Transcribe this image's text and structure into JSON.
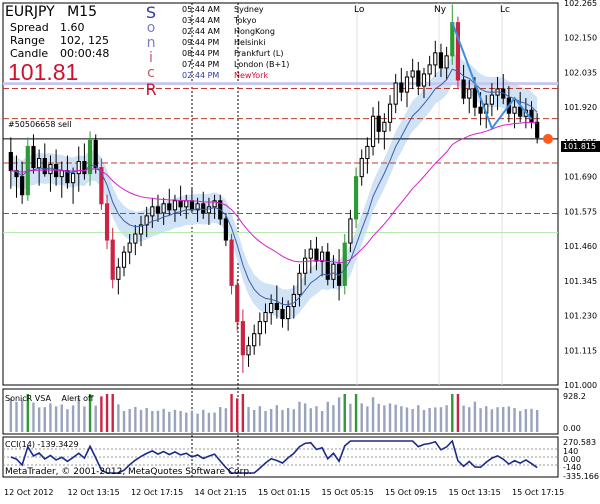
{
  "header": {
    "symbol": "EURJPY",
    "timeframe": "M15",
    "spread_label": "Spread",
    "spread_value": "1.60",
    "range_label": "Range",
    "range_value": "102, 125",
    "candle_label": "Candle",
    "candle_value": "00:00:48",
    "price": "101.81",
    "brand_letters": [
      "S",
      "o",
      "n",
      "i",
      "c",
      "R"
    ]
  },
  "sessions": [
    {
      "time": "05:44 AM",
      "name": "Sydney",
      "highlight": false
    },
    {
      "time": "03:44 AM",
      "name": "Tokyo",
      "highlight": false
    },
    {
      "time": "02:44 AM",
      "name": "HongKong",
      "highlight": false
    },
    {
      "time": "09:44 PM",
      "name": "Helsinki",
      "highlight": false
    },
    {
      "time": "08:44 PM",
      "name": "Frankfurt  (L)",
      "highlight": false
    },
    {
      "time": "07:44 PM",
      "name": "London  (B+1)",
      "highlight": false
    },
    {
      "time": "02:44 PM",
      "name": "NewYork",
      "highlight": true
    }
  ],
  "chart_labels": {
    "order_label": "#50506658 sell",
    "lo_label": "Lo",
    "ny_label": "Ny",
    "lc_label": "Lc",
    "current_price": "101.815"
  },
  "colors": {
    "bull": "#2d9a34",
    "bear": "#cc2244",
    "ma_fast": "#3d5fa8",
    "ma_slow": "#d81fc9",
    "band": "#cfe2f6",
    "dash_red": "#c0392b",
    "price_dot": "#ff5a1f",
    "accent_brand": "#2e3aa8"
  },
  "vsa_panel": {
    "label": "SonicR VSA",
    "alert": "Alert off",
    "scale_top": "928.2",
    "scale_bottom": "0.00"
  },
  "cci_panel": {
    "label": "CCI(14) -139.3429",
    "scale": [
      "270.583",
      "140",
      "0.00",
      "-140",
      "-335.166"
    ]
  },
  "footer": {
    "copyright": "MetaTrader, © 2001-2012, MetaQuotes Software Corp."
  },
  "chart_data": {
    "type": "candlestick",
    "symbol": "EURJPY",
    "timeframe": "M15",
    "y_ticks": [
      "102.265",
      "102.150",
      "102.035",
      "101.920",
      "101.805",
      "101.690",
      "101.575",
      "101.460",
      "101.345",
      "101.230",
      "101.115",
      "101.000"
    ],
    "ylim": [
      101.0,
      102.265
    ],
    "x_ticks": [
      "12 Oct 2012",
      "12 Oct 13:15",
      "12 Oct 17:15",
      "14 Oct 21:15",
      "15 Oct 01:15",
      "15 Oct 05:15",
      "15 Oct 09:15",
      "15 Oct 13:15",
      "15 Oct 17:15"
    ],
    "horizontal_levels": [
      {
        "value": 101.982,
        "style": "dash-red"
      },
      {
        "value": 101.882,
        "style": "dash-red"
      },
      {
        "value": 101.815,
        "style": "solid-black"
      },
      {
        "value": 101.735,
        "style": "dash-red"
      },
      {
        "value": 101.568,
        "style": "dash-red"
      },
      {
        "value": 101.505,
        "style": "solid-lightgreen"
      },
      {
        "value": 101.998,
        "style": "solid-lavender"
      }
    ],
    "candles": [
      [
        101.77,
        101.82,
        101.65,
        101.71
      ],
      [
        101.71,
        101.76,
        101.62,
        101.69
      ],
      [
        101.69,
        101.74,
        101.6,
        101.63
      ],
      [
        101.63,
        101.82,
        101.61,
        101.79
      ],
      [
        101.79,
        101.83,
        101.7,
        101.72
      ],
      [
        101.72,
        101.78,
        101.66,
        101.75
      ],
      [
        101.75,
        101.8,
        101.69,
        101.7
      ],
      [
        101.7,
        101.76,
        101.64,
        101.73
      ],
      [
        101.73,
        101.78,
        101.66,
        101.69
      ],
      [
        101.69,
        101.74,
        101.62,
        101.71
      ],
      [
        101.71,
        101.76,
        101.65,
        101.67
      ],
      [
        101.67,
        101.72,
        101.6,
        101.7
      ],
      [
        101.7,
        101.79,
        101.64,
        101.74
      ],
      [
        101.74,
        101.8,
        101.68,
        101.7
      ],
      [
        101.7,
        101.84,
        101.66,
        101.81
      ],
      [
        101.81,
        101.83,
        101.7,
        101.72
      ],
      [
        101.72,
        101.75,
        101.58,
        101.6
      ],
      [
        101.6,
        101.63,
        101.45,
        101.48
      ],
      [
        101.48,
        101.52,
        101.32,
        101.35
      ],
      [
        101.35,
        101.42,
        101.3,
        101.39
      ],
      [
        101.39,
        101.46,
        101.36,
        101.44
      ],
      [
        101.44,
        101.5,
        101.4,
        101.47
      ],
      [
        101.47,
        101.53,
        101.43,
        101.5
      ],
      [
        101.5,
        101.56,
        101.46,
        101.53
      ],
      [
        101.53,
        101.59,
        101.49,
        101.56
      ],
      [
        101.56,
        101.62,
        101.52,
        101.59
      ],
      [
        101.59,
        101.63,
        101.54,
        101.57
      ],
      [
        101.57,
        101.62,
        101.53,
        101.6
      ],
      [
        101.6,
        101.65,
        101.56,
        101.58
      ],
      [
        101.58,
        101.63,
        101.54,
        101.61
      ],
      [
        101.61,
        101.66,
        101.56,
        101.59
      ],
      [
        101.59,
        101.63,
        101.55,
        101.61
      ],
      [
        101.61,
        101.65,
        101.57,
        101.58
      ],
      [
        101.58,
        101.62,
        101.54,
        101.6
      ],
      [
        101.6,
        101.64,
        101.55,
        101.57
      ],
      [
        101.57,
        101.62,
        101.53,
        101.59
      ],
      [
        101.59,
        101.63,
        101.55,
        101.61
      ],
      [
        101.61,
        101.63,
        101.53,
        101.55
      ],
      [
        101.55,
        101.57,
        101.46,
        101.48
      ],
      [
        101.48,
        101.5,
        101.3,
        101.33
      ],
      [
        101.33,
        101.35,
        101.18,
        101.21
      ],
      [
        101.21,
        101.25,
        101.04,
        101.1
      ],
      [
        101.1,
        101.16,
        101.06,
        101.13
      ],
      [
        101.13,
        101.2,
        101.1,
        101.17
      ],
      [
        101.17,
        101.24,
        101.13,
        101.21
      ],
      [
        101.21,
        101.27,
        101.17,
        101.24
      ],
      [
        101.24,
        101.3,
        101.2,
        101.27
      ],
      [
        101.27,
        101.33,
        101.22,
        101.25
      ],
      [
        101.25,
        101.29,
        101.19,
        101.22
      ],
      [
        101.22,
        101.28,
        101.18,
        101.26
      ],
      [
        101.26,
        101.33,
        101.22,
        101.3
      ],
      [
        101.3,
        101.4,
        101.26,
        101.37
      ],
      [
        101.37,
        101.45,
        101.33,
        101.42
      ],
      [
        101.42,
        101.48,
        101.37,
        101.45
      ],
      [
        101.45,
        101.49,
        101.38,
        101.41
      ],
      [
        101.41,
        101.46,
        101.36,
        101.44
      ],
      [
        101.44,
        101.47,
        101.33,
        101.35
      ],
      [
        101.35,
        101.43,
        101.32,
        101.4
      ],
      [
        101.4,
        101.45,
        101.28,
        101.33
      ],
      [
        101.33,
        101.5,
        101.3,
        101.47
      ],
      [
        101.47,
        101.58,
        101.44,
        101.55
      ],
      [
        101.55,
        101.72,
        101.52,
        101.69
      ],
      [
        101.69,
        101.78,
        101.66,
        101.75
      ],
      [
        101.75,
        101.82,
        101.7,
        101.79
      ],
      [
        101.79,
        101.92,
        101.76,
        101.89
      ],
      [
        101.89,
        101.94,
        101.8,
        101.84
      ],
      [
        101.84,
        101.9,
        101.78,
        101.87
      ],
      [
        101.87,
        101.96,
        101.84,
        101.93
      ],
      [
        101.93,
        102.03,
        101.9,
        102.0
      ],
      [
        102.0,
        102.05,
        101.94,
        101.97
      ],
      [
        101.97,
        102.04,
        101.92,
        102.02
      ],
      [
        102.02,
        102.08,
        101.98,
        102.04
      ],
      [
        102.04,
        102.07,
        101.96,
        101.99
      ],
      [
        101.99,
        102.05,
        101.95,
        102.03
      ],
      [
        102.03,
        102.09,
        101.99,
        102.06
      ],
      [
        102.06,
        102.14,
        102.02,
        102.1
      ],
      [
        102.1,
        102.13,
        102.02,
        102.05
      ],
      [
        102.05,
        102.12,
        102.01,
        102.09
      ],
      [
        102.09,
        102.26,
        102.06,
        102.2
      ],
      [
        102.2,
        102.22,
        101.98,
        102.01
      ],
      [
        102.01,
        102.06,
        101.93,
        101.95
      ],
      [
        101.95,
        102.01,
        101.9,
        101.98
      ],
      [
        101.98,
        102.02,
        101.89,
        101.92
      ],
      [
        101.92,
        101.97,
        101.86,
        101.9
      ],
      [
        101.9,
        101.96,
        101.85,
        101.93
      ],
      [
        101.93,
        102.0,
        101.89,
        101.96
      ],
      [
        101.96,
        102.02,
        101.91,
        101.98
      ],
      [
        101.98,
        102.03,
        101.93,
        101.95
      ],
      [
        101.95,
        101.99,
        101.87,
        101.9
      ],
      [
        101.9,
        101.95,
        101.85,
        101.92
      ],
      [
        101.92,
        101.97,
        101.87,
        101.89
      ],
      [
        101.89,
        101.95,
        101.85,
        101.91
      ],
      [
        101.91,
        101.94,
        101.85,
        101.87
      ],
      [
        101.87,
        101.9,
        101.8,
        101.82
      ]
    ]
  }
}
